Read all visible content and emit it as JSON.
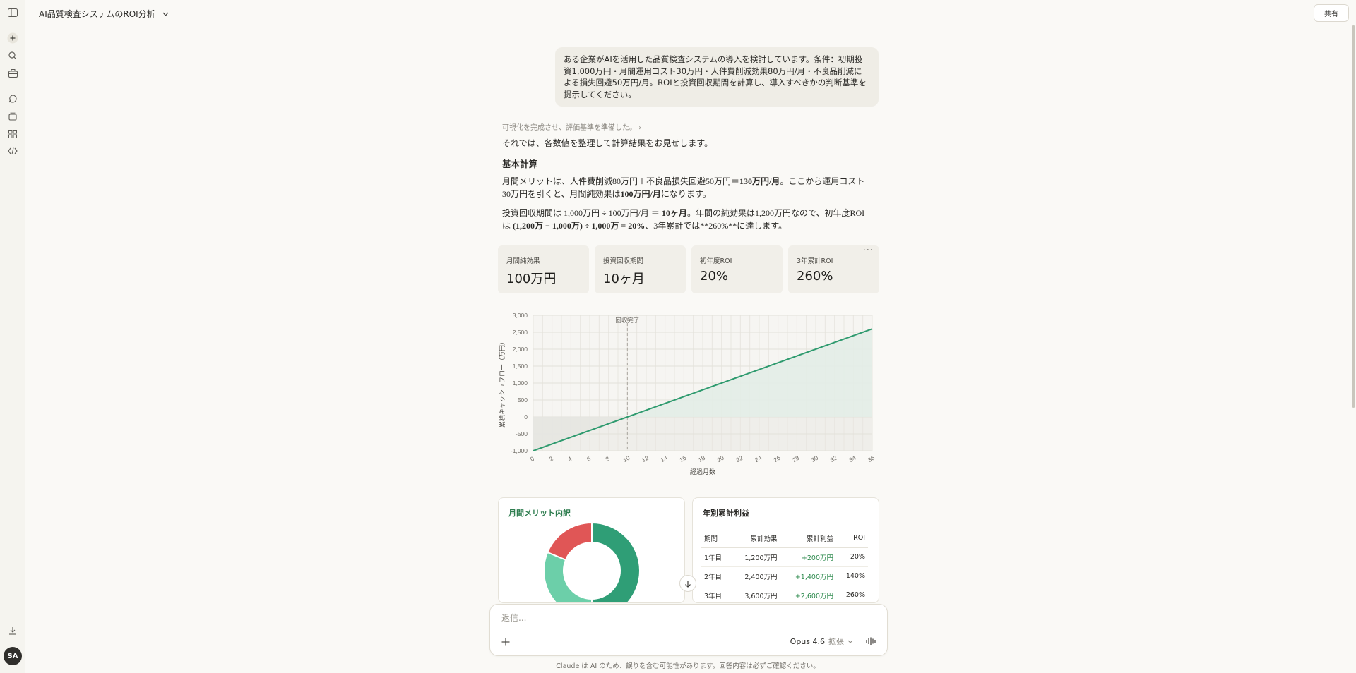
{
  "sidebar": {
    "icons": [
      "sidebar-toggle-icon",
      "new-chat-icon",
      "search-icon",
      "projects-icon",
      "chats-icon",
      "artifacts-icon",
      "apps-icon",
      "code-icon",
      "download-icon"
    ],
    "avatar": "SA"
  },
  "header": {
    "title": "AI品質検査システムのROI分析",
    "share_label": "共有"
  },
  "user_message": "ある企業がAIを活用した品質検査システムの導入を検討しています。条件：初期投資1,000万円・月間運用コスト30万円・人件費削減効果80万円/月・不良品削減による損失回避50万円/月。ROIと投資回収期間を計算し、導入すべきかの判断基準を提示してください。",
  "assistant": {
    "thinking_summary": "可視化を完成させ、評価基準を準備した。",
    "intro": "それでは、各数値を整理して計算結果をお見せします。",
    "heading": "基本計算",
    "para1_a": "月間メリットは、人件費削減80万円＋不良品損失回避50万円＝",
    "para1_b": "130万円/月",
    "para1_c": "。ここから運用コスト30万円を引くと、月間純効果は",
    "para1_d": "100万円/月",
    "para1_e": "になります。",
    "para2_a": "投資回収期間は 1,000万円 ÷ 100万円/月 ＝ ",
    "para2_b": "10ヶ月",
    "para2_c": "。年間の純効果は1,200万円なので、初年度ROIは ",
    "para2_d": "(1,200万 − 1,000万) ÷ 1,000万 = 20%",
    "para2_e": "、3年累計では**260%**に達します。"
  },
  "cards": [
    {
      "label": "月間純効果",
      "value": "100万円"
    },
    {
      "label": "投資回収期間",
      "value": "10ヶ月"
    },
    {
      "label": "初年度ROI",
      "value": "20%"
    },
    {
      "label": "3年累計ROI",
      "value": "260%"
    }
  ],
  "chart_data": {
    "type": "area",
    "ylabel": "累積キャッシュフロー（万円）",
    "xlabel": "経過月数",
    "annotation": "回収完了",
    "annotation_x": 10,
    "x_ticks": [
      0,
      2,
      4,
      6,
      8,
      10,
      12,
      14,
      16,
      18,
      20,
      22,
      24,
      26,
      28,
      30,
      32,
      34,
      36
    ],
    "y_ticks": [
      -1000,
      -500,
      0,
      500,
      1000,
      1500,
      2000,
      2500,
      3000
    ],
    "y_tick_labels": [
      "-1,000",
      "-500",
      "0",
      "500",
      "1,000",
      "1,500",
      "2,000",
      "2,500",
      "3,000"
    ],
    "xlim": [
      0,
      36
    ],
    "ylim": [
      -1000,
      3000
    ],
    "grid": true,
    "line_color": "#2e9a6e",
    "series": [
      {
        "x": [
          0,
          36
        ],
        "y": [
          -1000,
          2600
        ]
      }
    ]
  },
  "breakdown": {
    "title": "月間メリット内訳",
    "slices": [
      {
        "value": 80,
        "color": "#2f9e76"
      },
      {
        "value": 50,
        "color": "#6ccfa9"
      },
      {
        "value": 30,
        "color": "#e05656"
      }
    ]
  },
  "yearly": {
    "title": "年別累計利益",
    "headers": [
      "期間",
      "累計効果",
      "累計利益",
      "ROI"
    ],
    "rows": [
      [
        "1年目",
        "1,200万円",
        "+200万円",
        "20%"
      ],
      [
        "2年目",
        "2,400万円",
        "+1,400万円",
        "140%"
      ],
      [
        "3年目",
        "3,600万円",
        "+2,600万円",
        "260%"
      ]
    ]
  },
  "composer": {
    "placeholder": "返信...",
    "model": "Opus 4.6",
    "mode": "拡張"
  },
  "disclaimer": "Claude は AI のため、誤りを含む可能性があります。回答内容は必ずご確認ください。"
}
